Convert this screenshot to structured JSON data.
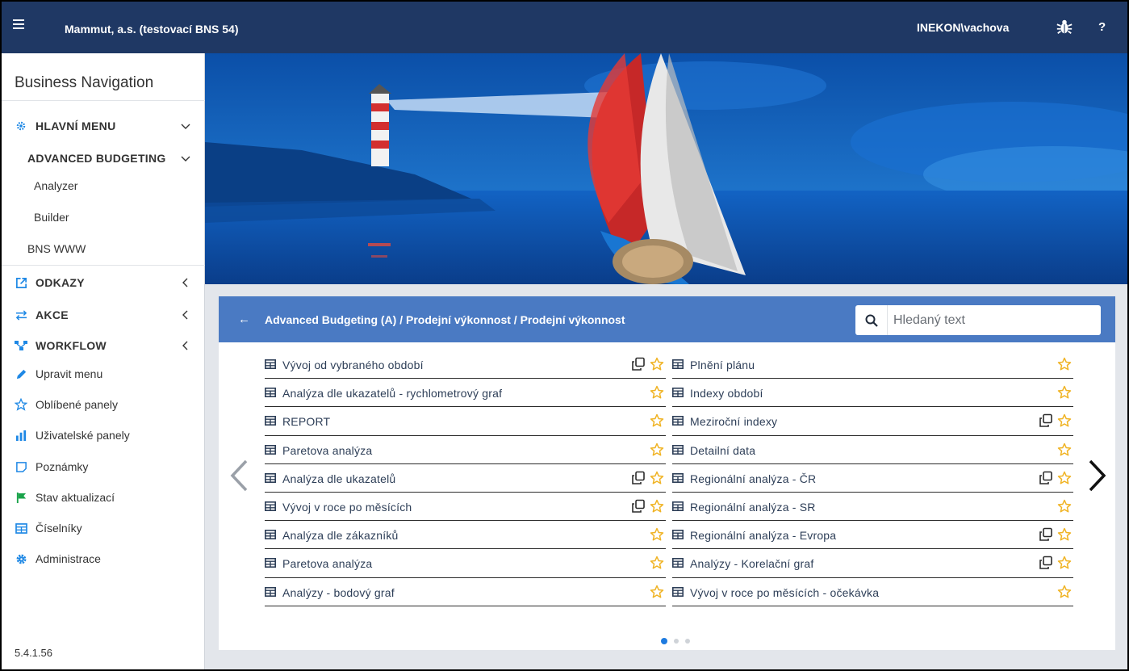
{
  "header": {
    "company": "Mammut, a.s. (testovací BNS 54)",
    "user": "INEKON\\vachova",
    "help": "?"
  },
  "sidebar": {
    "title": "Business Navigation",
    "items": [
      {
        "label": "HLAVNÍ MENU",
        "icon": "gear-icon",
        "color": "#1e88e5"
      },
      {
        "label": "ADVANCED BUDGETING"
      },
      {
        "label": "Analyzer"
      },
      {
        "label": "Builder"
      },
      {
        "label": "BNS WWW"
      },
      {
        "label": "ODKAZY",
        "icon": "external-link-icon",
        "color": "#1e88e5"
      },
      {
        "label": "AKCE",
        "icon": "swap-icon",
        "color": "#1e88e5"
      },
      {
        "label": "WORKFLOW",
        "icon": "workflow-icon",
        "color": "#1e88e5"
      },
      {
        "label": "Upravit menu",
        "icon": "pencil-icon",
        "color": "#1e88e5"
      },
      {
        "label": "Oblíbené panely",
        "icon": "star-outline-icon",
        "color": "#1e88e5"
      },
      {
        "label": "Uživatelské panely",
        "icon": "bar-chart-icon",
        "color": "#1e88e5"
      },
      {
        "label": "Poznámky",
        "icon": "note-icon",
        "color": "#1e88e5"
      },
      {
        "label": "Stav aktualizací",
        "icon": "flag-icon",
        "color": "#1aa34a"
      },
      {
        "label": "Číselníky",
        "icon": "table-icon",
        "color": "#1e88e5"
      },
      {
        "label": "Administrace",
        "icon": "settings-icon",
        "color": "#1e88e5"
      }
    ],
    "version": "5.4.1.56"
  },
  "panel": {
    "back": "←",
    "breadcrumb": "Advanced Budgeting (A)  /  Prodejní výkonnost  /  Prodejní výkonnost",
    "search_placeholder": "Hledaný text",
    "left_items": [
      {
        "label": "Vývoj od vybraného období",
        "copy": true
      },
      {
        "label": "Analýza dle ukazatelů - rychlometrový graf",
        "copy": false
      },
      {
        "label": "REPORT",
        "copy": false
      },
      {
        "label": "Paretova analýza",
        "copy": false
      },
      {
        "label": "Analýza dle ukazatelů",
        "copy": true
      },
      {
        "label": "Vývoj v roce po měsících",
        "copy": true
      },
      {
        "label": "Analýza dle zákazníků",
        "copy": false
      },
      {
        "label": "Paretova analýza",
        "copy": false
      },
      {
        "label": "Analýzy - bodový graf",
        "copy": false
      }
    ],
    "right_items": [
      {
        "label": "Plnění plánu",
        "copy": false
      },
      {
        "label": "Indexy období",
        "copy": false
      },
      {
        "label": "Meziroční indexy",
        "copy": true
      },
      {
        "label": "Detailní data",
        "copy": false
      },
      {
        "label": "Regionální analýza - ČR",
        "copy": true
      },
      {
        "label": "Regionální analýza - SR",
        "copy": false
      },
      {
        "label": "Regionální analýza - Evropa",
        "copy": true
      },
      {
        "label": "Analýzy - Korelační graf",
        "copy": true
      },
      {
        "label": "Vývoj v roce po měsících - očekávka",
        "copy": false
      }
    ],
    "page_indicator": {
      "pages": 3,
      "active": 1
    }
  },
  "colors": {
    "topbar": "#1f3864",
    "panel_header": "#4a7ac3",
    "accent": "#1e88e5",
    "star": "#f0b323"
  }
}
